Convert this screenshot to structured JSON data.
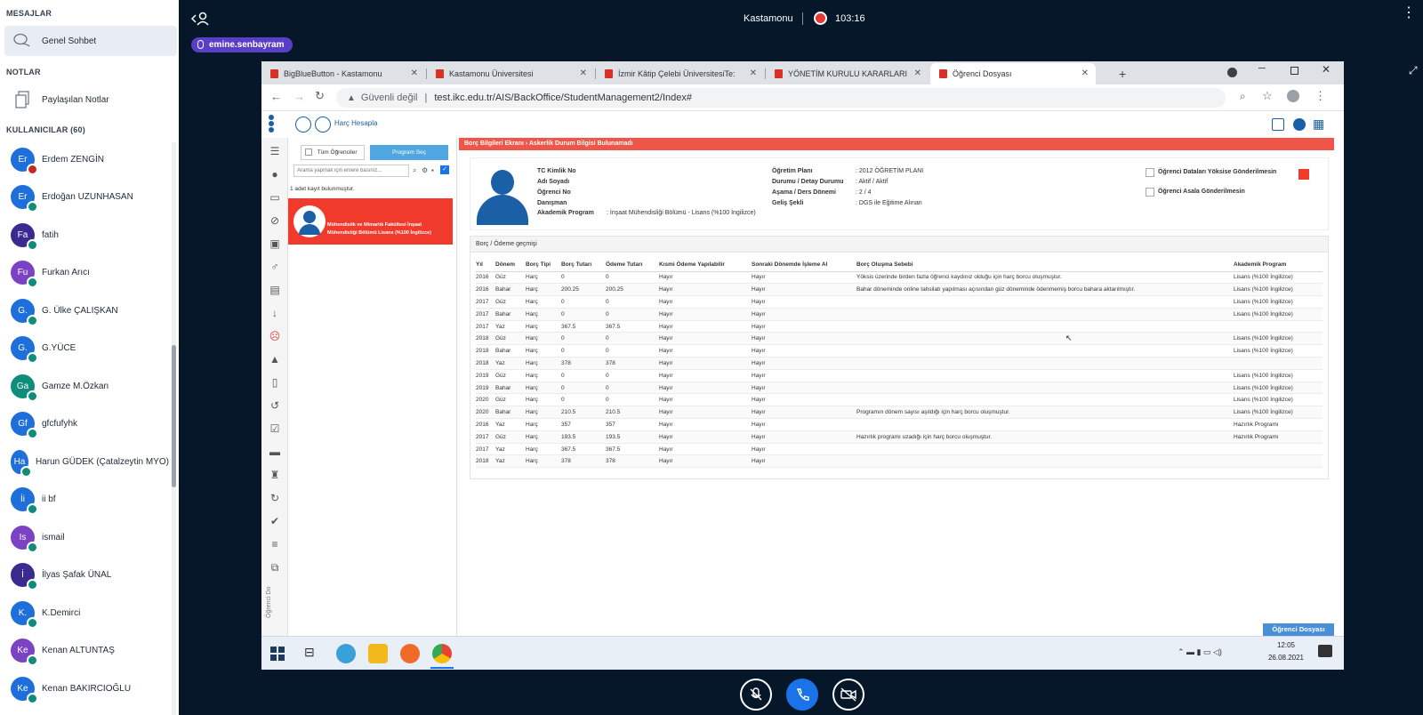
{
  "sidebar": {
    "messages_title": "MESAJLAR",
    "public_chat": "Genel Sohbet",
    "notes_title": "NOTLAR",
    "shared_notes": "Paylaşılan Notlar",
    "users_title": "KULLANICILAR (60)",
    "users": [
      {
        "initials": "Er",
        "name": "Erdem ZENGİN",
        "color": "#1e6fd9",
        "badge": "red"
      },
      {
        "initials": "Er",
        "name": "Erdoğan UZUNHASAN",
        "color": "#1e6fd9",
        "badge": "teal"
      },
      {
        "initials": "Fa",
        "name": "fatih",
        "color": "#3b2a8f",
        "badge": "teal"
      },
      {
        "initials": "Fu",
        "name": "Furkan Arıcı",
        "color": "#7b43c4",
        "badge": "teal"
      },
      {
        "initials": "G.",
        "name": "G. Ülke ÇALIŞKAN",
        "color": "#1e6fd9",
        "badge": "teal"
      },
      {
        "initials": "G.",
        "name": "G.YÜCE",
        "color": "#1e6fd9",
        "badge": "teal"
      },
      {
        "initials": "Ga",
        "name": "Gamze M.Özkan",
        "color": "#0f8c7a",
        "badge": "teal"
      },
      {
        "initials": "Gf",
        "name": "gfcfufyhk",
        "color": "#1e6fd9",
        "badge": "teal"
      },
      {
        "initials": "Ha",
        "name": "Harun GÜDEK (Çatalzeytin MYO)",
        "color": "#1e6fd9",
        "badge": "teal"
      },
      {
        "initials": "İi",
        "name": "ii bf",
        "color": "#1e6fd9",
        "badge": "teal"
      },
      {
        "initials": "Is",
        "name": "ismail",
        "color": "#7b43c4",
        "badge": "teal"
      },
      {
        "initials": "İ",
        "name": "İlyas Şafak ÜNAL",
        "color": "#3b2a8f",
        "badge": "teal"
      },
      {
        "initials": "K.",
        "name": "K.Demirci",
        "color": "#1e6fd9",
        "badge": "teal"
      },
      {
        "initials": "Ke",
        "name": "Kenan ALTUNTAŞ",
        "color": "#7b43c4",
        "badge": "teal"
      },
      {
        "initials": "Ke",
        "name": "Kenan BAKIRCIOĞLU",
        "color": "#1e6fd9",
        "badge": "teal"
      }
    ]
  },
  "topbar": {
    "meeting_title": "Kastamonu",
    "recording_time": "103:16",
    "presenter": "emine.senbayram"
  },
  "browser": {
    "tabs": [
      {
        "label": "BigBlueButton - Kastamonu",
        "fav": "#d93025"
      },
      {
        "label": "Kastamonu Üniversitesi",
        "fav": "#d93025"
      },
      {
        "label": "İzmir Kâtip Çelebi ÜniversitesiTe:",
        "fav": "#d93025"
      },
      {
        "label": "YÖNETİM KURULU KARARLARI",
        "fav": "#d93025"
      },
      {
        "label": "Öğrenci Dosyası",
        "fav": "#d93025"
      }
    ],
    "insecure": "Güvenli değil",
    "url": "test.ikc.edu.tr/AIS/BackOffice/StudentManagement2/Index#"
  },
  "app": {
    "header_link": "Harç Hesapla",
    "all_students": "Tüm Öğrenciler",
    "select_program": "Program Seç",
    "search_placeholder": "Arama yapmak için enlere basınız...",
    "record_count": "1 adet kayıt bulunmuştur.",
    "student_card_text": "Mühendislik ve Mimarlık Fakültesi İnşaat Mühendisliği Bölümü Lisans (%100 İngilizce)",
    "side_caption": "Öğrenci Do",
    "breadcrumb": "Borç Bilgileri Ekranı  ›  Askerlik Durum Bilgisi Bulunamadı",
    "info": {
      "tc": "TC Kimlik No",
      "name": "Adı Soyadı",
      "student_no": "Öğrenci No",
      "advisor": "Danışman",
      "program_lbl": "Akademik Program",
      "program_val": ": İnşaat Mühendisliği Bölümü - Lisans (%100 İngilizce)",
      "plan_lbl": "Öğretim Planı",
      "plan_val": ": 2012 ÖĞRETİM PLANI",
      "status_lbl": "Durumu / Detay Durumu",
      "status_val": ": Aktif / Aktif",
      "stage_lbl": "Aşama / Ders Dönemi",
      "stage_val": ": 2 / 4",
      "entry_lbl": "Geliş Şekli",
      "entry_val": ": DGS ile Eğitime Alınan",
      "check1": "Öğrenci Dataları Yöksise Gönderilmesin",
      "check2": "Öğrenci Asala Gönderilmesin"
    },
    "history_title": "Borç / Ödeme geçmişi",
    "columns": [
      "Yıl",
      "Dönem",
      "Borç Tipi",
      "Borç Tutarı",
      "Ödeme Tutarı",
      "Kısmi Ödeme Yapılabilir",
      "Sonraki Dönemde İşleme Al",
      "Borç Oluşma Sebebi",
      "Akademik Program"
    ],
    "rows": [
      [
        "2016",
        "Güz",
        "Harç",
        "0",
        "0",
        "Hayır",
        "Hayır",
        "Yöksis üzerinde birden fazla öğrenci kaydınız olduğu için harç borcu oluşmuştur.",
        "Lisans (%100 İngilizce)"
      ],
      [
        "2016",
        "Bahar",
        "Harç",
        "200.25",
        "200.25",
        "Hayır",
        "Hayır",
        "Bahar döneminde online tahsilatı yapılması açısından güz döneminde ödenmemiş borcu bahara aktarılmıştır.",
        "Lisans (%100 İngilizce)"
      ],
      [
        "2017",
        "Güz",
        "Harç",
        "0",
        "0",
        "Hayır",
        "Hayır",
        "",
        "Lisans (%100 İngilizce)"
      ],
      [
        "2017",
        "Bahar",
        "Harç",
        "0",
        "0",
        "Hayır",
        "Hayır",
        "",
        "Lisans (%100 İngilizce)"
      ],
      [
        "2017",
        "Yaz",
        "Harç",
        "367.5",
        "367.5",
        "Hayır",
        "Hayır",
        "",
        ""
      ],
      [
        "2018",
        "Güz",
        "Harç",
        "0",
        "0",
        "Hayır",
        "Hayır",
        "",
        "Lisans (%100 İngilizce)"
      ],
      [
        "2018",
        "Bahar",
        "Harç",
        "0",
        "0",
        "Hayır",
        "Hayır",
        "",
        "Lisans (%100 İngilizce)"
      ],
      [
        "2018",
        "Yaz",
        "Harç",
        "378",
        "378",
        "Hayır",
        "Hayır",
        "",
        ""
      ],
      [
        "2019",
        "Güz",
        "Harç",
        "0",
        "0",
        "Hayır",
        "Hayır",
        "",
        "Lisans (%100 İngilizce)"
      ],
      [
        "2019",
        "Bahar",
        "Harç",
        "0",
        "0",
        "Hayır",
        "Hayır",
        "",
        "Lisans (%100 İngilizce)"
      ],
      [
        "2020",
        "Güz",
        "Harç",
        "0",
        "0",
        "Hayır",
        "Hayır",
        "",
        "Lisans (%100 İngilizce)"
      ],
      [
        "2020",
        "Bahar",
        "Harç",
        "210.5",
        "210.5",
        "Hayır",
        "Hayır",
        "Programın dönem sayısı aşıldığı için harç borcu oluşmuştur.",
        "Lisans (%100 İngilizce)"
      ],
      [
        "2016",
        "Yaz",
        "Harç",
        "357",
        "357",
        "Hayır",
        "Hayır",
        "",
        "Hazırlık Programı"
      ],
      [
        "2017",
        "Güz",
        "Harç",
        "193.5",
        "193.5",
        "Hayır",
        "Hayır",
        "Hazırlık programı uzadığı için harç borcu oluşmuştur.",
        "Hazırlık Programı"
      ],
      [
        "2017",
        "Yaz",
        "Harç",
        "367.5",
        "367.5",
        "Hayır",
        "Hayır",
        "",
        ""
      ],
      [
        "2018",
        "Yaz",
        "Harç",
        "378",
        "378",
        "Hayır",
        "Hayır",
        "",
        ""
      ]
    ],
    "file_button": "Öğrenci Dosyası"
  },
  "taskbar": {
    "time": "12:05",
    "date": "26.08.2021"
  }
}
